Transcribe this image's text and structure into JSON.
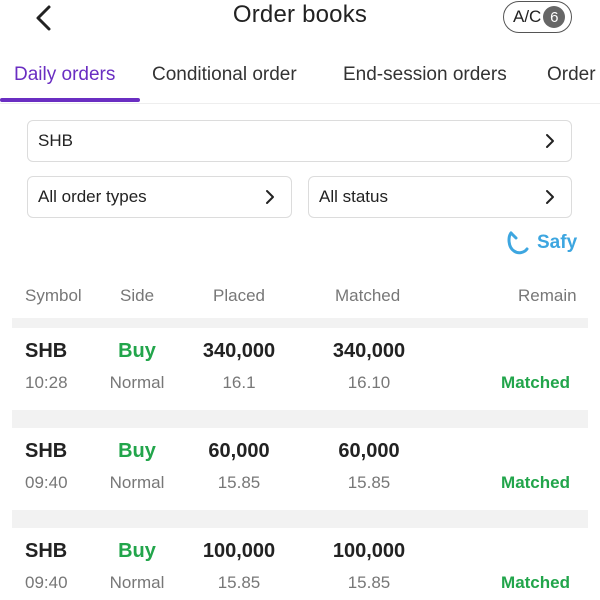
{
  "header": {
    "title": "Order books",
    "account_label": "A/C",
    "account_count": "6"
  },
  "tabs": [
    {
      "label": "Daily orders",
      "active": true
    },
    {
      "label": "Conditional order",
      "active": false
    },
    {
      "label": "End-session orders",
      "active": false
    },
    {
      "label": "Order",
      "active": false
    }
  ],
  "filters": {
    "symbol": "SHB",
    "order_type": "All order types",
    "status": "All status"
  },
  "safy": {
    "label": "Safy"
  },
  "columns": {
    "symbol": "Symbol",
    "side": "Side",
    "placed": "Placed",
    "matched": "Matched",
    "remain": "Remain"
  },
  "orders": [
    {
      "symbol": "SHB",
      "time": "10:28",
      "side": "Buy",
      "type": "Normal",
      "placed_qty": "340,000",
      "placed_price": "16.1",
      "matched_qty": "340,000",
      "matched_price": "16.10",
      "status": "Matched"
    },
    {
      "symbol": "SHB",
      "time": "09:40",
      "side": "Buy",
      "type": "Normal",
      "placed_qty": "60,000",
      "placed_price": "15.85",
      "matched_qty": "60,000",
      "matched_price": "15.85",
      "status": "Matched"
    },
    {
      "symbol": "SHB",
      "time": "09:40",
      "side": "Buy",
      "type": "Normal",
      "placed_qty": "100,000",
      "placed_price": "15.85",
      "matched_qty": "100,000",
      "matched_price": "15.85",
      "status": "Matched"
    }
  ],
  "colors": {
    "accent": "#6a2ec2",
    "buy": "#22a54b",
    "matched": "#22a54b",
    "safy": "#3da6e0"
  }
}
